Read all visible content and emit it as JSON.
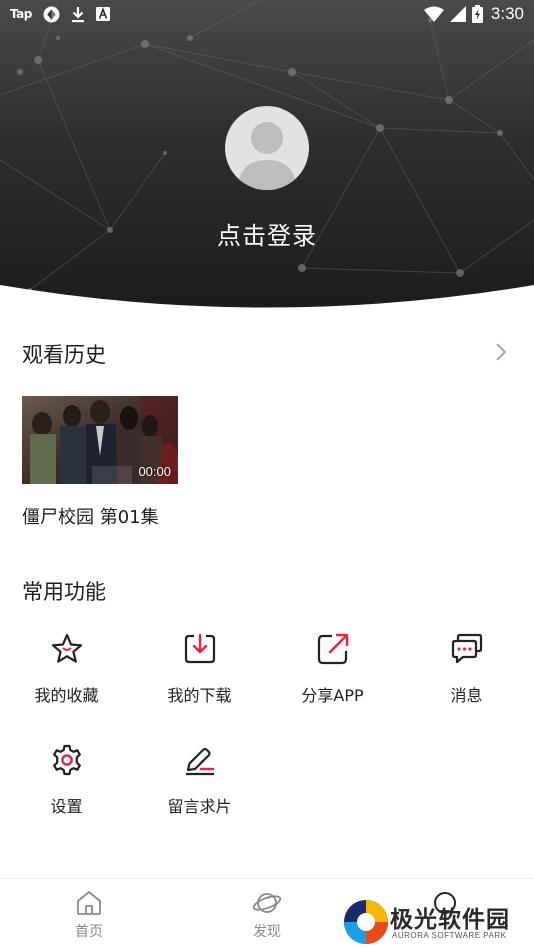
{
  "status_bar": {
    "left_icons": [
      "tap-logo",
      "sync-icon",
      "download-icon",
      "keyboard-a-icon"
    ],
    "tap_label": "Tap",
    "right_icons": [
      "wifi-icon",
      "signal-icon",
      "battery-icon"
    ],
    "time": "3:30"
  },
  "profile": {
    "login_label": "点击登录"
  },
  "history": {
    "title": "观看历史",
    "items": [
      {
        "title": "僵尸校园 第01集",
        "duration": "00:00"
      }
    ]
  },
  "functions": {
    "title": "常用功能",
    "items": [
      {
        "label": "我的收藏",
        "icon": "star-icon"
      },
      {
        "label": "我的下载",
        "icon": "download-box-icon"
      },
      {
        "label": "分享APP",
        "icon": "share-icon"
      },
      {
        "label": "消息",
        "icon": "message-icon"
      },
      {
        "label": "设置",
        "icon": "gear-icon"
      },
      {
        "label": "留言求片",
        "icon": "pen-icon"
      }
    ]
  },
  "bottom_nav": {
    "items": [
      {
        "label": "首页",
        "icon": "home-icon"
      },
      {
        "label": "发现",
        "icon": "planet-icon"
      },
      {
        "label": "",
        "icon": "profile-icon"
      }
    ]
  },
  "watermark": {
    "text": "极光软件园",
    "subtext": "AURORA SOFTWARE PARK"
  },
  "colors": {
    "accent": "#e8243c",
    "header_dark": "#1c1c1c",
    "text": "#222222",
    "nav_inactive": "#8a8a8a"
  }
}
